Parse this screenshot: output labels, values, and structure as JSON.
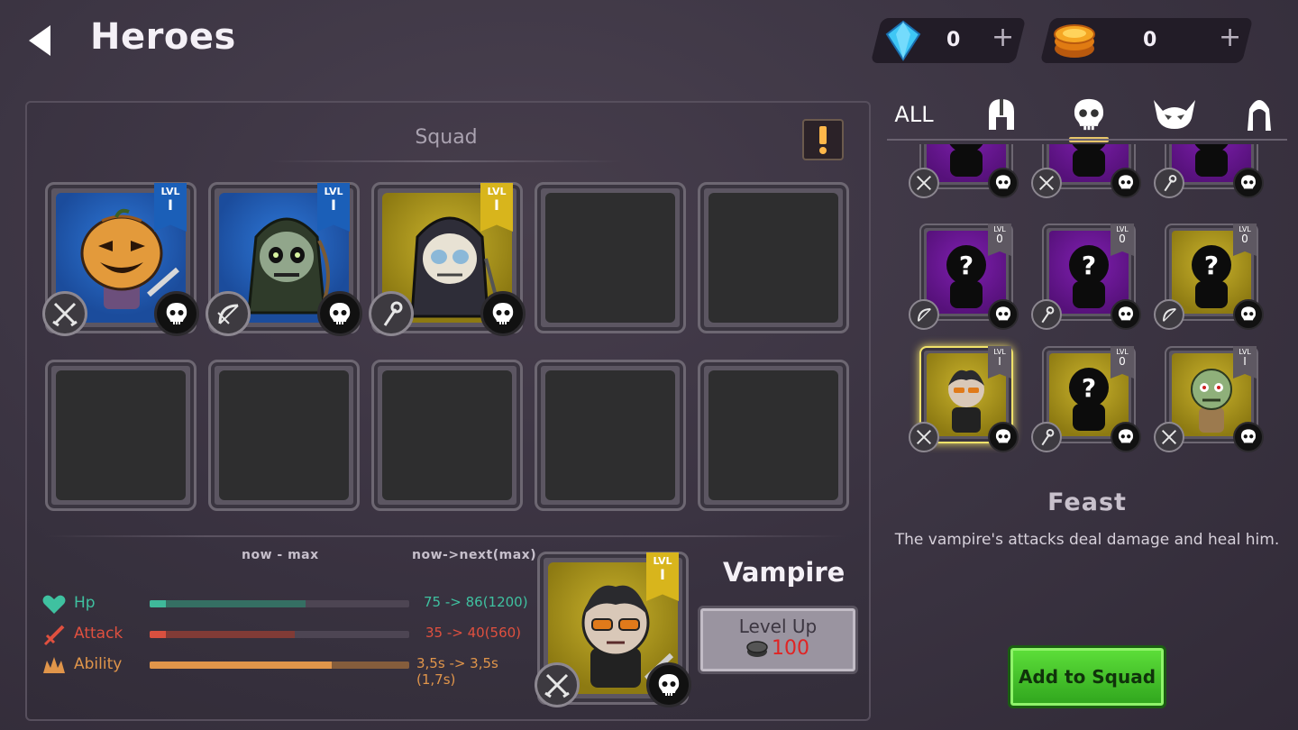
{
  "header": {
    "title": "Heroes"
  },
  "currencies": [
    {
      "name": "gems",
      "value": "0",
      "plus": "+"
    },
    {
      "name": "coins",
      "value": "0",
      "plus": "+"
    }
  ],
  "squad": {
    "title": "Squad",
    "slots": [
      {
        "hero": "pumpkin",
        "level_label": "LVL",
        "level": "I",
        "role": "swords-icon",
        "faction": "skull-icon",
        "rarity": "blue"
      },
      {
        "hero": "hooded-archer",
        "level_label": "LVL",
        "level": "I",
        "role": "bow-icon",
        "faction": "skull-icon",
        "rarity": "blue"
      },
      {
        "hero": "reaper",
        "level_label": "LVL",
        "level": "I",
        "role": "staff-icon",
        "faction": "skull-icon",
        "rarity": "gold"
      },
      {
        "empty": true
      },
      {
        "empty": true
      },
      {
        "empty": true
      },
      {
        "empty": true
      },
      {
        "empty": true
      },
      {
        "empty": true
      },
      {
        "empty": true
      }
    ]
  },
  "stats": {
    "col_now_max": "now - max",
    "col_next": "now->next(max)",
    "rows": [
      {
        "label": "Hp",
        "value": "75 -> 86(1200)",
        "now_fraction": 0.0625,
        "max_fraction": 0.6,
        "color": "#3fb99a"
      },
      {
        "label": "Attack",
        "value": "35 -> 40(560)",
        "now_fraction": 0.0625,
        "max_fraction": 0.56,
        "color": "#d9503f"
      },
      {
        "label": "Ability",
        "value": "3,5s -> 3,5s (1,7s)",
        "now_fraction": 0.7,
        "max_fraction": 1.0,
        "color": "#e0954a"
      }
    ]
  },
  "selected_hero": {
    "name": "Vampire",
    "level_label": "LVL",
    "level": "I",
    "level_up_label": "Level Up",
    "level_up_cost": "100"
  },
  "filters": [
    {
      "label": "ALL"
    },
    {
      "label": "",
      "icon": "helmet-icon"
    },
    {
      "label": "",
      "icon": "skull-icon"
    },
    {
      "label": "",
      "icon": "demon-icon"
    },
    {
      "label": "",
      "icon": "hood-icon"
    }
  ],
  "roster": [
    {
      "rarity": "purple",
      "level_label": "",
      "level": "",
      "role": "swords-icon",
      "known": false
    },
    {
      "rarity": "purple",
      "level_label": "",
      "level": "",
      "role": "swords-icon",
      "known": false
    },
    {
      "rarity": "purple",
      "level_label": "",
      "level": "",
      "role": "staff-icon",
      "known": false
    },
    {
      "rarity": "purple",
      "level_label": "LVL",
      "level": "0",
      "role": "bow-icon",
      "known": false
    },
    {
      "rarity": "purple",
      "level_label": "LVL",
      "level": "0",
      "role": "staff-icon",
      "known": false
    },
    {
      "rarity": "gold",
      "level_label": "LVL",
      "level": "0",
      "role": "bow-icon",
      "known": false
    },
    {
      "rarity": "gold",
      "level_label": "LVL",
      "level": "I",
      "role": "swords-icon",
      "known": true,
      "hero": "vampire",
      "selected": true
    },
    {
      "rarity": "gold",
      "level_label": "LVL",
      "level": "0",
      "role": "staff-icon",
      "known": false
    },
    {
      "rarity": "gold",
      "level_label": "LVL",
      "level": "I",
      "role": "swords-icon",
      "known": true,
      "hero": "zombie"
    }
  ],
  "ability": {
    "name": "Feast",
    "description": "The vampire's attacks deal damage and heal him."
  },
  "actions": {
    "add_to_squad": "Add to Squad"
  }
}
